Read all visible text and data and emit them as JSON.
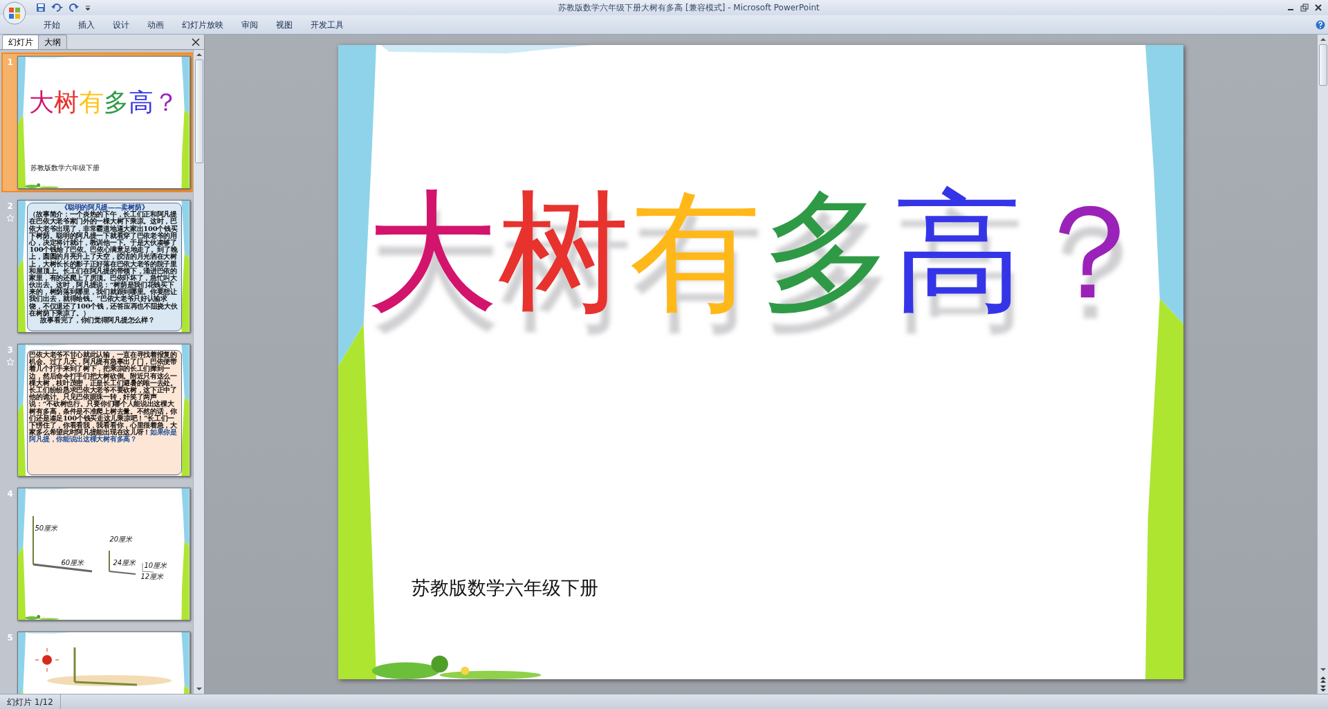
{
  "window": {
    "title": "苏教版数学六年级下册大树有多高 [兼容模式] - Microsoft PowerPoint"
  },
  "ribbon_tabs": [
    "开始",
    "插入",
    "设计",
    "动画",
    "幻灯片放映",
    "审阅",
    "视图",
    "开发工具"
  ],
  "panel_tabs": [
    {
      "label": "幻灯片",
      "selected": true
    },
    {
      "label": "大纲",
      "selected": false
    }
  ],
  "slides": [
    {
      "number": "1",
      "kind": "title",
      "selected": true,
      "animated": false,
      "title_chars": [
        {
          "char": "大",
          "color": "#d3146c"
        },
        {
          "char": "树",
          "color": "#e8322e"
        },
        {
          "char": "有",
          "color": "#ffc21a"
        },
        {
          "char": "多",
          "color": "#2f9a46"
        },
        {
          "char": "高",
          "color": "#3535e8"
        },
        {
          "char": "？",
          "color": "#9b22b8"
        }
      ],
      "subtitle": "苏教版数学六年级下册"
    },
    {
      "number": "2",
      "kind": "scroll",
      "selected": false,
      "animated": true,
      "heading": "《聪明的阿凡提——卖树荫》",
      "body": "（故事简介：一个炎热的下午，长工们正和阿凡提在巴依大老爷家门外的一棵大树下乘凉。这时，巴依大老爷出现了，非常霸道地逼大家出100个钱买下树荫。聪明的阿凡提一下就看穿了巴依老爷的用心，决定将计就计，教训他一下。于是大伙凑够了100个钱给了巴依。巴依心满意足地走了。到了晚上，圆圆的月亮升上了天空，皎洁的月光洒在大树上，大树长长的影子正好落在巴依大老爷的院子里和屋顶上。长工们在阿凡提的带领下，涌进巴依的家里，有的还爬上了房顶。巴依吓坏了，急忙叫大伙出去。这时，阿凡提说：“树荫是我们花钱买下来的，树荫落到哪里，我们就跟到哪里。你要想让我们出去，就得给钱。”巴依大老爷只好认输求饶，不仅退还了100个钱，还答应再也不阻挠大伙在树荫下乘凉了。）",
      "closing": "故事看完了，你们觉得阿凡提怎么样？"
    },
    {
      "number": "3",
      "kind": "parchment",
      "selected": false,
      "animated": true,
      "body": "巴依大老爷不甘心就此认输，一直在寻找着报复的机会。过了几天，阿凡提有急事出了门，巴依便带着几个打手来到了树下，把乘凉的长工们撵到一边，然后命令打手们把大树砍倒。附近只有这么一棵大树，枝叶茂密，正是长工们避暑的唯一去处。长工们纷纷恳求巴依大老爷不要砍树，这下正中了他的诡计。只见巴依眼珠一转，奸笑了两声说：“不砍树也行。只要你们哪个人能说出这棵大树有多高，条件是不准爬上树去量。不然的话，你们还是凑足100个钱买走这儿乘凉吧！”长工们一下愣住了，你看看我，我看看你，心里很着急，大家多么希望此时阿凡提能出现在这儿呀！",
      "question": "如果你是阿凡提，你能说出这棵大树有多高？"
    },
    {
      "number": "4",
      "kind": "measure",
      "selected": false,
      "animated": false,
      "labels": [
        "50厘米",
        "60厘米",
        "20厘米",
        "24厘米",
        "10厘米",
        "12厘米"
      ]
    },
    {
      "number": "5",
      "kind": "picture",
      "selected": false,
      "animated": false
    }
  ],
  "current_slide": {
    "title_chars": [
      {
        "char": "大",
        "color": "#d3146c"
      },
      {
        "char": "树",
        "color": "#e8322e"
      },
      {
        "char": "有",
        "color": "#ffb81a"
      },
      {
        "char": "多",
        "color": "#2f9a46"
      },
      {
        "char": "高",
        "color": "#3535e8"
      },
      {
        "char": "？",
        "color": "#9b22b8"
      }
    ],
    "subtitle": "苏教版数学六年级下册"
  },
  "status_bar": {
    "slide_info": "幻灯片 1/12"
  }
}
